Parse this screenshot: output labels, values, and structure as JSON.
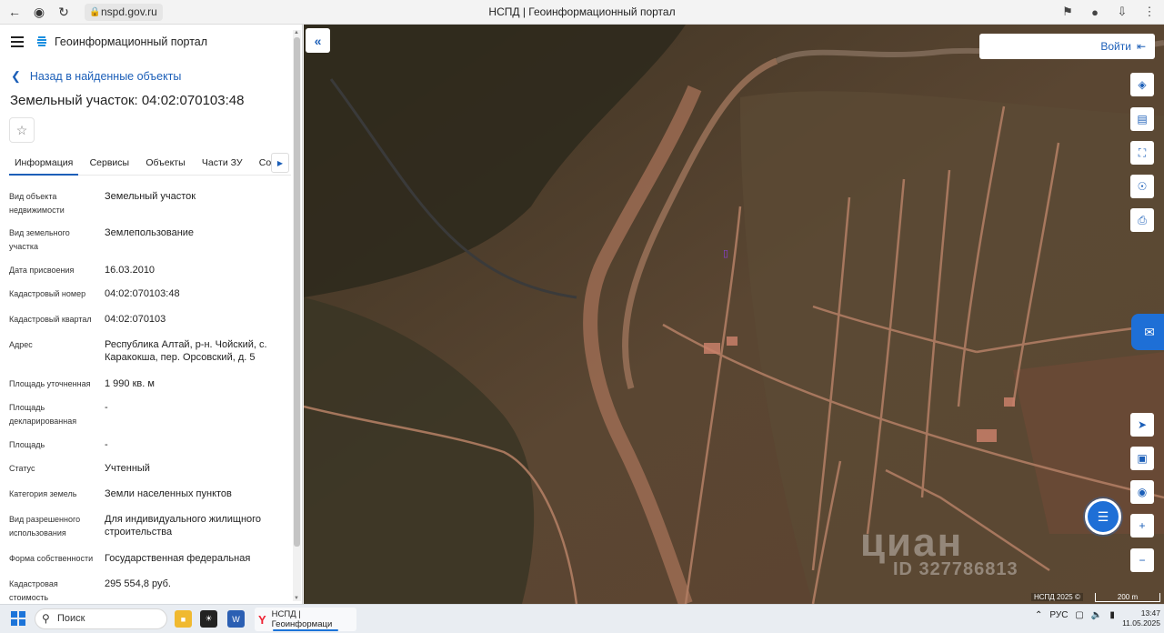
{
  "browser": {
    "url": "nspd.gov.ru",
    "tab_title": "НСПД | Геоинформационный портал"
  },
  "panel": {
    "portal_title": "Геоинформационный портал",
    "back_link": "Назад в найденные объекты",
    "page_title": "Земельный участок: 04:02:070103:48",
    "tabs": [
      "Информация",
      "Сервисы",
      "Объекты",
      "Части ЗУ",
      "Соста"
    ],
    "properties": [
      {
        "label_lines": [
          "Вид объекта",
          "недвижимости"
        ],
        "value": "Земельный участок"
      },
      {
        "label_lines": [
          "Вид земельного",
          "участка"
        ],
        "value": "Землепользование"
      },
      {
        "label_lines": [
          "Дата присвоения"
        ],
        "value": "16.03.2010"
      },
      {
        "label_lines": [
          "Кадастровый номер"
        ],
        "value": "04:02:070103:48"
      },
      {
        "label_lines": [
          "Кадастровый квартал"
        ],
        "value": "04:02:070103"
      },
      {
        "label_lines": [
          "Адрес"
        ],
        "value": "Республика Алтай, р-н. Чойский, с. Каракокша, пер. Орсовский, д. 5"
      },
      {
        "label_lines": [
          "Площадь уточненная"
        ],
        "value": "1 990 кв. м"
      },
      {
        "label_lines": [
          "Площадь",
          "декларированная"
        ],
        "value": "-"
      },
      {
        "label_lines": [
          "Площадь"
        ],
        "value": "-"
      },
      {
        "label_lines": [
          "Статус"
        ],
        "value": "Учтенный"
      },
      {
        "label_lines": [
          "Категория земель"
        ],
        "value": "Земли населенных пунктов"
      },
      {
        "label_lines": [
          "Вид разрешенного",
          "использования"
        ],
        "value": "Для индивидуального жилищного строительства"
      },
      {
        "label_lines": [
          "Форма собственности"
        ],
        "value": "Государственная федеральная"
      },
      {
        "label_lines": [
          "Кадастровая",
          "стоимость"
        ],
        "value": "295 554,8 руб."
      }
    ]
  },
  "map": {
    "login_label": "Войти",
    "tools": [
      "layers-icon",
      "ruler-icon",
      "area-select-icon",
      "share-icon",
      "print-icon",
      "locate-icon",
      "minimap-icon",
      "geo-pin-icon",
      "zoom-in-icon",
      "zoom-out-icon"
    ],
    "attribution": "НСПД 2025 ©",
    "scale_label": "200 m",
    "watermark": "циан",
    "watermark_id": "ID 327786813"
  },
  "taskbar": {
    "search_label": "Поиск",
    "app_label": "НСПД | Геоинформаци",
    "lang": "РУС",
    "time": "13:47",
    "date": "11.05.2025"
  },
  "colors": {
    "accent": "#1c5fb8",
    "action_blue": "#1e6fd6"
  }
}
